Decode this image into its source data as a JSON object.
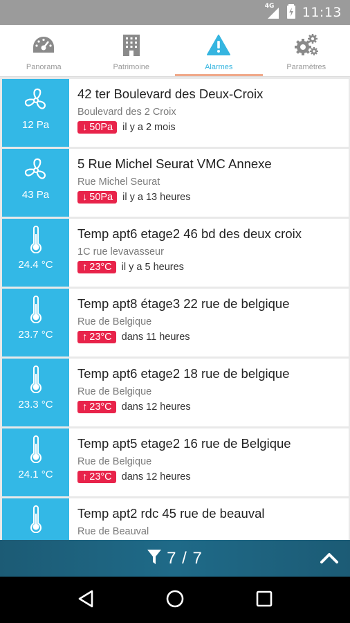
{
  "status_bar": {
    "network": "4G",
    "time": "11:13"
  },
  "tabs": [
    {
      "label": "Panorama",
      "icon": "gauge-icon",
      "active": false
    },
    {
      "label": "Patrimoine",
      "icon": "building-icon",
      "active": false
    },
    {
      "label": "Alarmes",
      "icon": "warning-icon",
      "active": true
    },
    {
      "label": "Paramètres",
      "icon": "gears-icon",
      "active": false
    }
  ],
  "alarms": [
    {
      "icon": "fan-icon",
      "value": "12 Pa",
      "title": "42 ter Boulevard des Deux-Croix",
      "address": "Boulevard des 2 Croix",
      "direction": "down",
      "arrow": "↓",
      "threshold": "50Pa",
      "when": "il y a 2 mois"
    },
    {
      "icon": "fan-icon",
      "value": "43 Pa",
      "title": "5 Rue Michel Seurat VMC Annexe",
      "address": "Rue Michel Seurat",
      "direction": "down",
      "arrow": "↓",
      "threshold": "50Pa",
      "when": "il y a 13 heures"
    },
    {
      "icon": "thermometer-icon",
      "value": "24.4 °C",
      "title": "Temp apt6 etage2 46 bd des deux croix",
      "address": "1C rue levavasseur",
      "direction": "up",
      "arrow": "↑",
      "threshold": "23°C",
      "when": "il y a 5 heures"
    },
    {
      "icon": "thermometer-icon",
      "value": "23.7 °C",
      "title": "Temp apt8 étage3 22 rue de belgique",
      "address": "Rue de Belgique",
      "direction": "up",
      "arrow": "↑",
      "threshold": "23°C",
      "when": "dans 11 heures"
    },
    {
      "icon": "thermometer-icon",
      "value": "23.3 °C",
      "title": "Temp apt6 etage2 18 rue de belgique",
      "address": "Rue de Belgique",
      "direction": "up",
      "arrow": "↑",
      "threshold": "23°C",
      "when": "dans 12 heures"
    },
    {
      "icon": "thermometer-icon",
      "value": "24.1 °C",
      "title": "Temp apt5 etage2 16 rue de Belgique",
      "address": "Rue de Belgique",
      "direction": "up",
      "arrow": "↑",
      "threshold": "23°C",
      "when": "dans 12 heures"
    },
    {
      "icon": "thermometer-icon",
      "value": "",
      "title": "Temp apt2 rdc 45 rue de beauval",
      "address": "Rue de Beauval",
      "direction": "up",
      "arrow": "",
      "threshold": "",
      "when": ""
    }
  ],
  "filter": {
    "icon": "filter-icon",
    "count": "7 / 7"
  },
  "colors": {
    "accent": "#33b8e6",
    "alarm_badge": "#e8234a",
    "active_tab": "#35b5e0",
    "filter_bar": "#1f6a88"
  },
  "nav": [
    "back-icon",
    "home-icon",
    "recents-icon"
  ]
}
